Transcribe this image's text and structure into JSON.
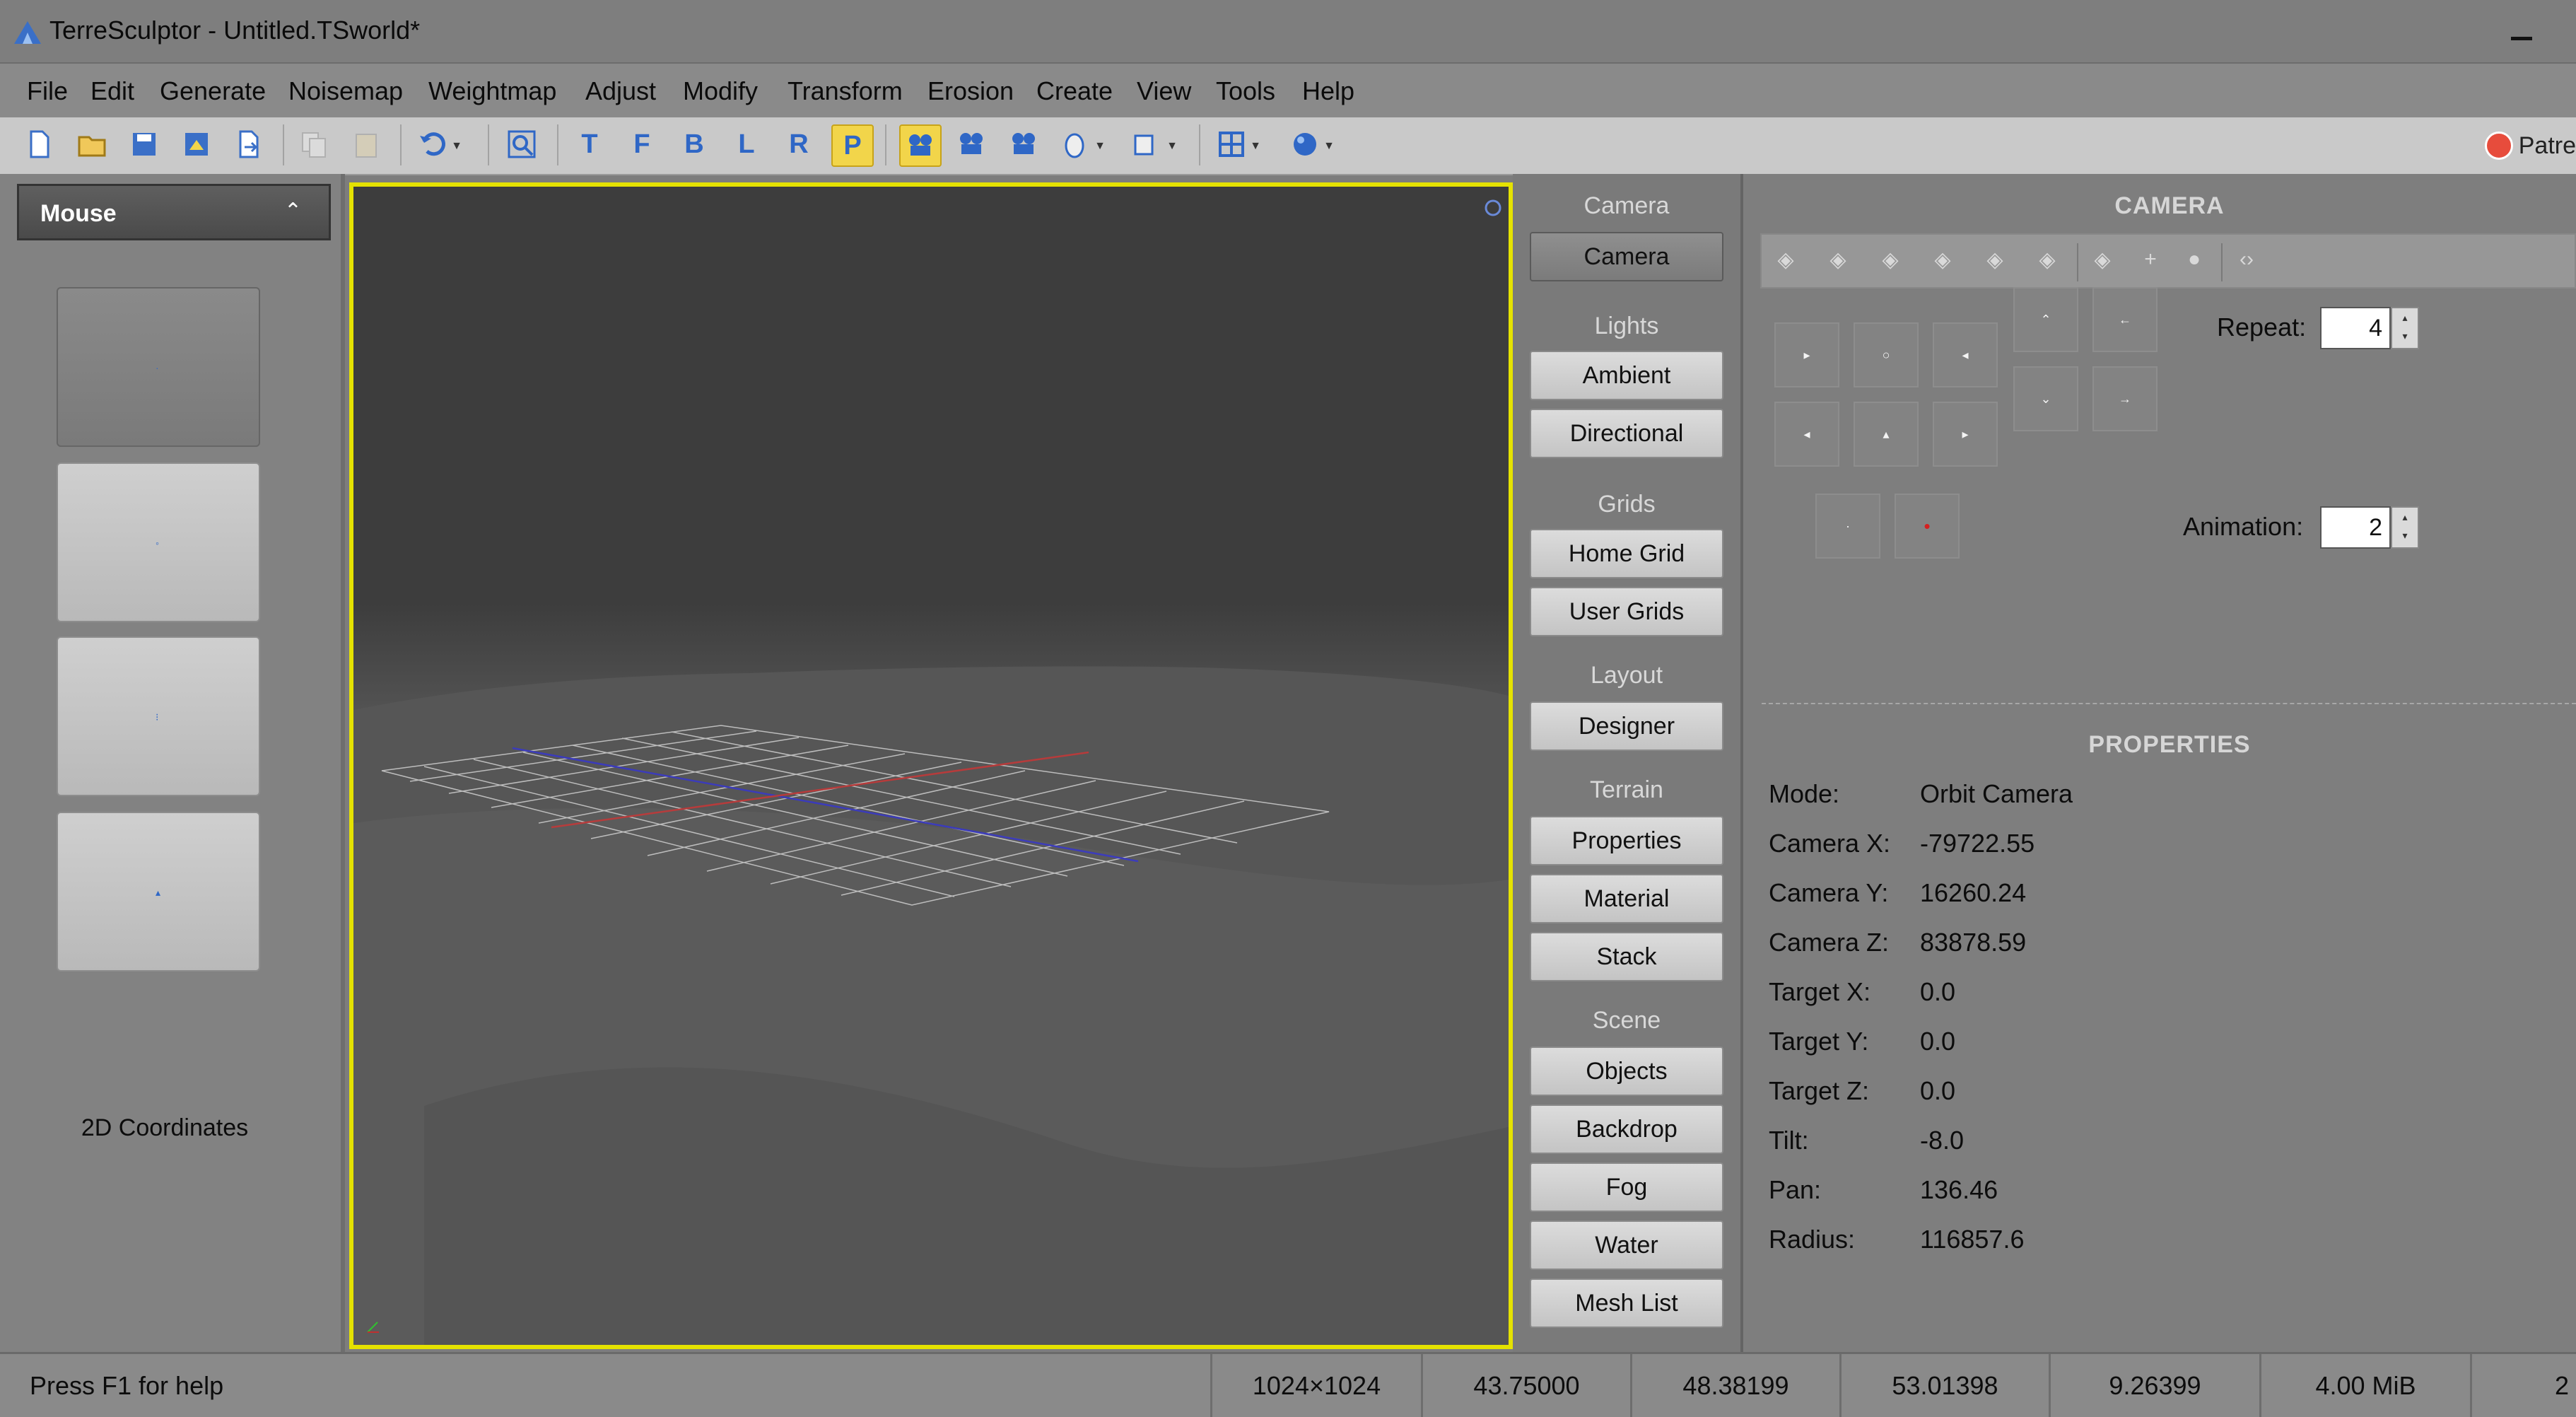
{
  "app": {
    "title": "TerreSculptor - Untitled.TSworld*"
  },
  "menu": [
    "File",
    "Edit",
    "Generate",
    "Noisemap",
    "Weightmap",
    "Adjust",
    "Modify",
    "Transform",
    "Erosion",
    "Create",
    "View",
    "Tools",
    "Help"
  ],
  "toolbar": {
    "letter_views": [
      "T",
      "F",
      "B",
      "L",
      "R",
      "P"
    ],
    "active_view": "P",
    "patreon_label": "Patre"
  },
  "left_panel": {
    "header": "Mouse",
    "coords_label": "2D Coordinates"
  },
  "categories": {
    "camera_title": "Camera",
    "camera_button": "Camera",
    "lights_title": "Lights",
    "ambient": "Ambient",
    "directional": "Directional",
    "grids_title": "Grids",
    "home_grid": "Home Grid",
    "user_grids": "User Grids",
    "layout_title": "Layout",
    "designer": "Designer",
    "terrain_title": "Terrain",
    "properties": "Properties",
    "material": "Material",
    "stack": "Stack",
    "scene_title": "Scene",
    "objects": "Objects",
    "backdrop": "Backdrop",
    "fog": "Fog",
    "water": "Water",
    "mesh_list": "Mesh List"
  },
  "camera_panel": {
    "title": "CAMERA",
    "repeat_label": "Repeat:",
    "repeat_value": "4",
    "animation_label": "Animation:",
    "animation_value": "2"
  },
  "properties_panel": {
    "title": "PROPERTIES",
    "rows": [
      {
        "label": "Mode:",
        "value": "Orbit Camera"
      },
      {
        "label": "Camera X:",
        "value": "-79722.55"
      },
      {
        "label": "Camera Y:",
        "value": "16260.24"
      },
      {
        "label": "Camera Z:",
        "value": "83878.59"
      },
      {
        "label": "Target X:",
        "value": "0.0"
      },
      {
        "label": "Target Y:",
        "value": "0.0"
      },
      {
        "label": "Target Z:",
        "value": "0.0"
      },
      {
        "label": "Tilt:",
        "value": "-8.0"
      },
      {
        "label": "Pan:",
        "value": "136.46"
      },
      {
        "label": "Radius:",
        "value": "116857.6"
      }
    ]
  },
  "status": {
    "help": "Press F1 for help",
    "cells": [
      "1024×1024",
      "43.75000",
      "48.38199",
      "53.01398",
      "9.26399",
      "4.00 MiB",
      "2"
    ]
  },
  "colors": {
    "viewport_border": "#e5e200",
    "active_tool": "#f2d54a",
    "toolbar_icon": "#2f67c6"
  }
}
